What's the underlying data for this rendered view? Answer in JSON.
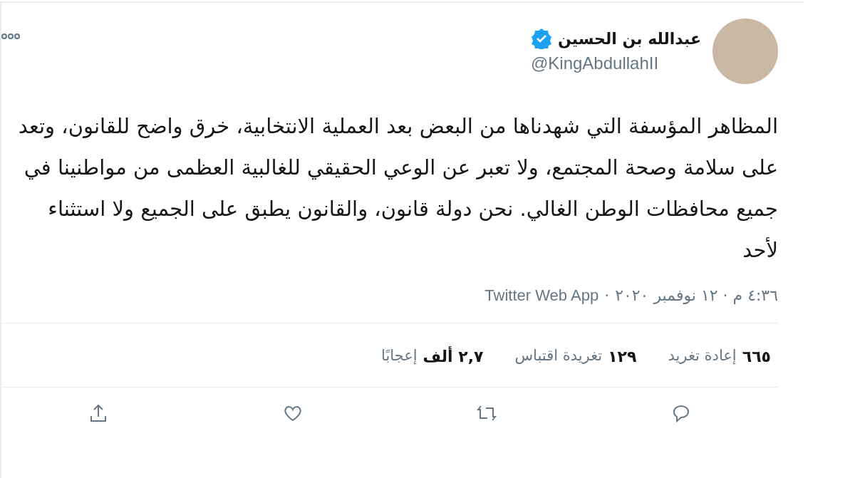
{
  "author": {
    "name": "عبدالله بن الحسين",
    "verified": true,
    "handle": "@KingAbdullahII"
  },
  "text": "المظاهر المؤسفة التي شهدناها من البعض بعد العملية الانتخابية، خرق واضح للقانون، وتعد على سلامة وصحة المجتمع، ولا تعبر عن الوعي الحقيقي للغالبية العظمى من مواطنينا في جميع محافظات الوطن الغالي. نحن دولة قانون، والقانون يطبق على الجميع ولا استثناء لأحد",
  "timestamp": "٤:٣٦ م · ١٢ نوفمبر ٢٠٢٠",
  "separator": "·",
  "source": "Twitter Web App",
  "stats": [
    {
      "count": "٦٦٥",
      "label": "إعادة تغريد"
    },
    {
      "count": "١٢٩",
      "label": "تغريدة اقتباس"
    },
    {
      "count": "٢,٧ ألف",
      "label": "إعجابًا"
    }
  ]
}
